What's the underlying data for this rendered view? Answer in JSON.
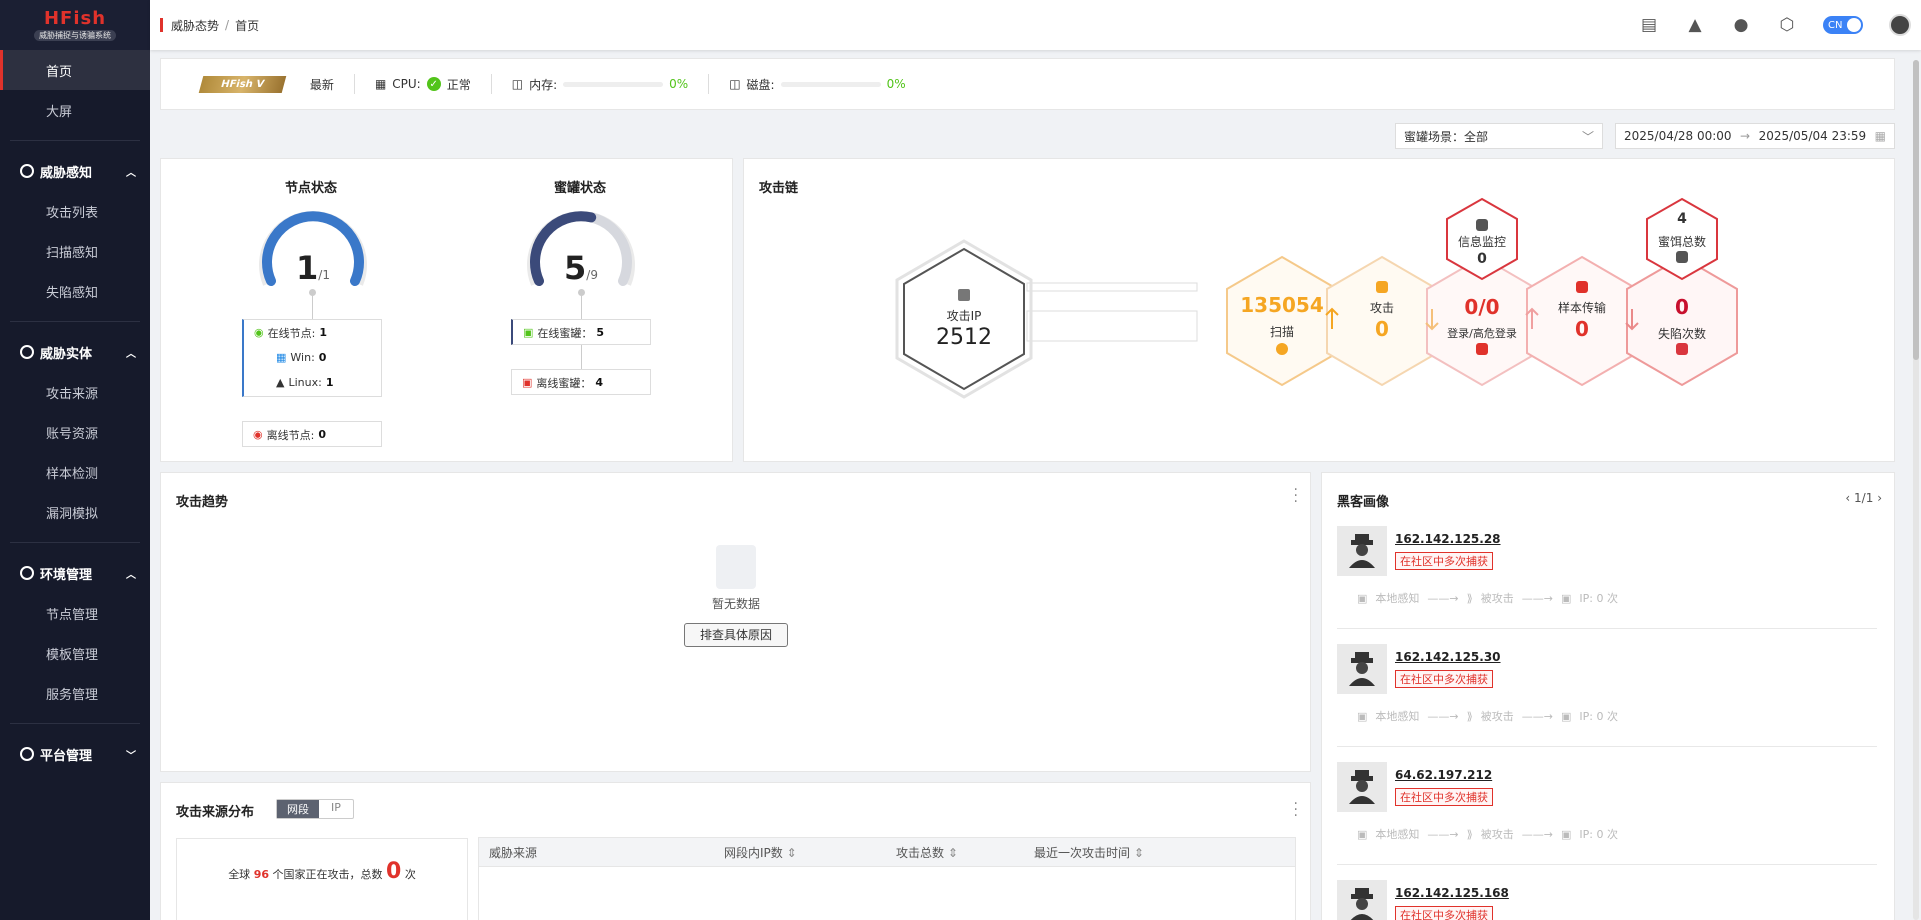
{
  "sidebar": {
    "logo_main": "HFish",
    "logo_sub": "威胁捕捉与诱骗系统",
    "top_items": [
      "首页",
      "大屏"
    ],
    "groups": [
      {
        "title": "威胁感知",
        "items": [
          "攻击列表",
          "扫描感知",
          "失陷感知"
        ]
      },
      {
        "title": "威胁实体",
        "items": [
          "攻击来源",
          "账号资源",
          "样本检测",
          "漏洞模拟"
        ]
      },
      {
        "title": "环境管理",
        "items": [
          "节点管理",
          "模板管理",
          "服务管理"
        ]
      },
      {
        "title": "平台管理",
        "items": []
      }
    ]
  },
  "header": {
    "breadcrumb_parent": "威胁态势",
    "breadcrumb_current": "首页",
    "lang_toggle": "CN",
    "icons": [
      "book-icon",
      "rocket-icon",
      "wechat-icon",
      "hexagon-icon"
    ]
  },
  "status": {
    "version_badge": "HFish V",
    "version_state": "最新",
    "cpu_label": "CPU:",
    "cpu_state": "正常",
    "mem_label": "内存:",
    "mem_value": "0%",
    "disk_label": "磁盘:",
    "disk_value": "0%"
  },
  "filters": {
    "scene_label": "蜜罐场景：全部",
    "date_start": "2025/04/28 00:00",
    "date_end": "2025/05/04 23:59"
  },
  "node_status": {
    "title": "节点状态",
    "value": "1",
    "total": "/1",
    "gauge_fraction": 1.0,
    "online_label": "在线节点:",
    "online_value": "1",
    "win_label": "Win:",
    "win_value": "0",
    "linux_label": "Linux:",
    "linux_value": "1",
    "offline_label": "离线节点:",
    "offline_value": "0"
  },
  "honeypot_status": {
    "title": "蜜罐状态",
    "value": "5",
    "total": "/9",
    "gauge_fraction": 0.5556,
    "online_label": "在线蜜罐：",
    "online_value": "5",
    "offline_label": "离线蜜罐：",
    "offline_value": "4"
  },
  "attack_chain": {
    "title": "攻击链",
    "attack_ip_label": "攻击IP",
    "attack_ip_value": "2512",
    "scan_value": "135054",
    "scan_label": "扫描",
    "attack_label": "攻击",
    "attack_value": "0",
    "login_value": "0/0",
    "login_label": "登录/高危登录",
    "sample_label": "样本传输",
    "sample_value": "0",
    "fall_value": "0",
    "fall_label": "失陷次数",
    "info_label": "信息监控",
    "info_value": "0",
    "honey_total_value": "4",
    "honey_total_label": "蜜饵总数"
  },
  "attack_trend": {
    "title": "攻击趋势",
    "empty_text": "暂无数据",
    "check_button": "排查具体原因"
  },
  "hacker_profile": {
    "title": "黑客画像",
    "pager": "1/1",
    "tag": "在社区中多次捕获",
    "flow": [
      "本地感知",
      "被攻击",
      "IP: 0 次"
    ],
    "ips": [
      "162.142.125.28",
      "162.142.125.30",
      "64.62.197.212",
      "162.142.125.168"
    ]
  },
  "attack_source": {
    "title": "攻击来源分布",
    "tab_segment": "网段",
    "tab_ip": "IP",
    "global_prefix": "全球",
    "country_count": "96",
    "global_mid": "个国家正在攻击，总数",
    "total_attacks": "0",
    "global_suffix": "次",
    "columns": [
      "威胁来源",
      "网段内IP数",
      "攻击总数",
      "最近一次攻击时间"
    ]
  },
  "colors": {
    "accent": "#e0322b",
    "sidebar_bg": "#161a2b",
    "gauge_blue": "#3a78c9",
    "gauge_navy": "#3b4a7a",
    "scan_orange": "#f5a623",
    "danger_red": "#d9363e"
  }
}
